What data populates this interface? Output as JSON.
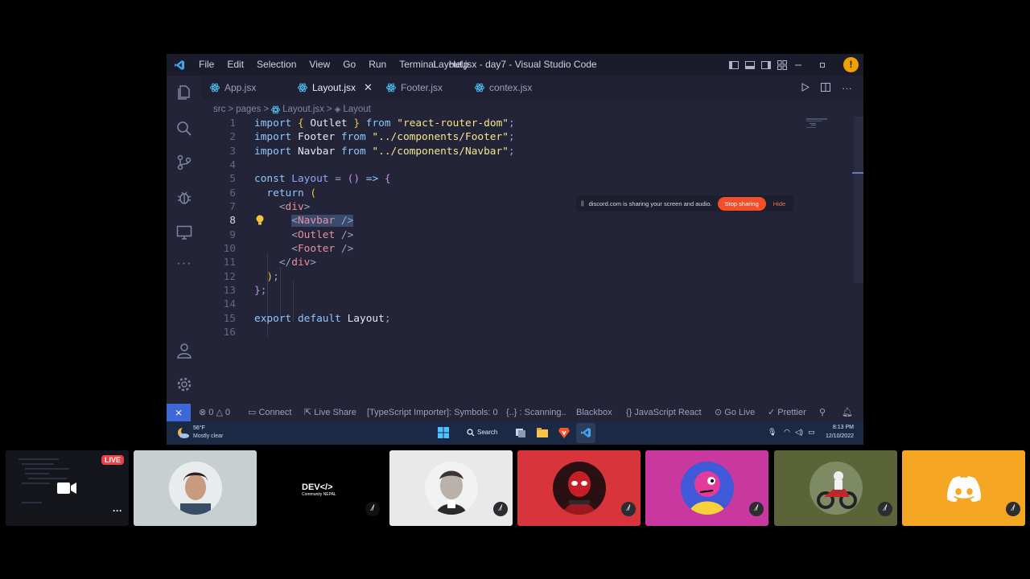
{
  "window": {
    "title": "Layout.jsx - day7 - Visual Studio Code",
    "menu": [
      "File",
      "Edit",
      "Selection",
      "View",
      "Go",
      "Run",
      "Terminal",
      "Help"
    ]
  },
  "tabs": [
    {
      "label": "App.jsx",
      "active": false
    },
    {
      "label": "Layout.jsx",
      "active": true
    },
    {
      "label": "Footer.jsx",
      "active": false
    },
    {
      "label": "contex.jsx",
      "active": false
    }
  ],
  "breadcrumb": [
    "src",
    "pages",
    "Layout.jsx",
    "Layout"
  ],
  "code": {
    "current_line": 8,
    "lines": [
      "import { Outlet } from \"react-router-dom\";",
      "import Footer from \"../components/Footer\";",
      "import Navbar from \"../components/Navbar\";",
      "",
      "const Layout = () => {",
      "  return (",
      "    <div>",
      "      <Navbar />",
      "      <Outlet />",
      "      <Footer />",
      "    </div>",
      "  );",
      "};",
      "",
      "export default Layout;",
      ""
    ]
  },
  "share_banner": {
    "message": "discord.com is sharing your screen and audio.",
    "stop_label": "Stop sharing",
    "hide_label": "Hide"
  },
  "status_bar": {
    "problems": "0",
    "warnings": "0",
    "connect": "Connect",
    "live_share": "Live Share",
    "importer": "[TypeScript Importer]: Symbols: 0",
    "scanning": "{..} : Scanning..",
    "blackbox": "Blackbox",
    "language": "JavaScript React",
    "go_live": "Go Live",
    "prettier": "Prettier"
  },
  "taskbar": {
    "temperature": "56°F",
    "condition": "Mostly clear",
    "search": "Search",
    "time": "8:13 PM",
    "date": "12/10/2022"
  },
  "participants": [
    {
      "name": "stream-preview",
      "badge": "LIVE"
    },
    {
      "name": "participant-2"
    },
    {
      "name": "dev-community",
      "label": "DEV</>",
      "sub": "Community NEPAL"
    },
    {
      "name": "participant-4"
    },
    {
      "name": "participant-5"
    },
    {
      "name": "participant-6"
    },
    {
      "name": "participant-7"
    },
    {
      "name": "participant-8"
    }
  ],
  "colors": {
    "editor_bg": "#232438",
    "accent_blue": "#3e68d6",
    "stop_red": "#f24e2a",
    "discord_yellow": "#f5a623",
    "live_red": "#ed4245"
  }
}
